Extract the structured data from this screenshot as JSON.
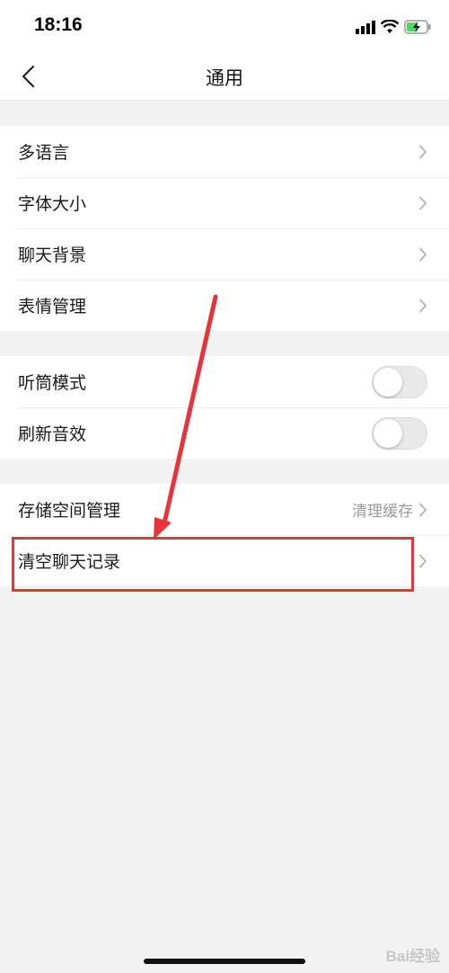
{
  "status_bar": {
    "time": "18:16"
  },
  "nav": {
    "title": "通用"
  },
  "groups": [
    {
      "items": [
        {
          "label": "多语言"
        },
        {
          "label": "字体大小"
        },
        {
          "label": "聊天背景"
        },
        {
          "label": "表情管理"
        }
      ]
    },
    {
      "items": [
        {
          "label": "听筒模式",
          "toggle_on": false
        },
        {
          "label": "刷新音效",
          "toggle_on": false
        }
      ]
    },
    {
      "items": [
        {
          "label": "存储空间管理",
          "detail": "清理缓存"
        },
        {
          "label": "清空聊天记录"
        }
      ]
    }
  ],
  "annotation": {
    "color": "#e8333a"
  },
  "watermark": "Bai经验"
}
